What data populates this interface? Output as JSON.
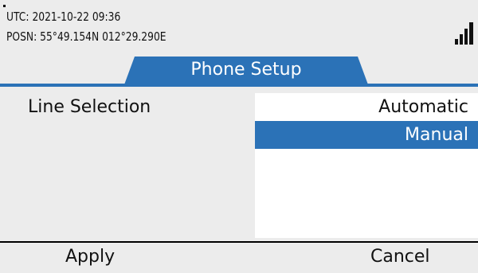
{
  "status": {
    "utc_text": "UTC:  2021-10-22  09:36",
    "posn_text": "POSN: 55°49.154N  012°29.290E",
    "signal_icon": "signal-strength-icon"
  },
  "tab": {
    "label": "Phone Setup"
  },
  "form": {
    "field_label": "Line Selection",
    "options": [
      {
        "label": "Automatic",
        "selected": false
      },
      {
        "label": "Manual",
        "selected": true
      }
    ]
  },
  "softkeys": {
    "left": "Apply",
    "right": "Cancel"
  },
  "colors": {
    "accent": "#2b72b7",
    "background": "#ececec",
    "list_background": "#ffffff"
  }
}
